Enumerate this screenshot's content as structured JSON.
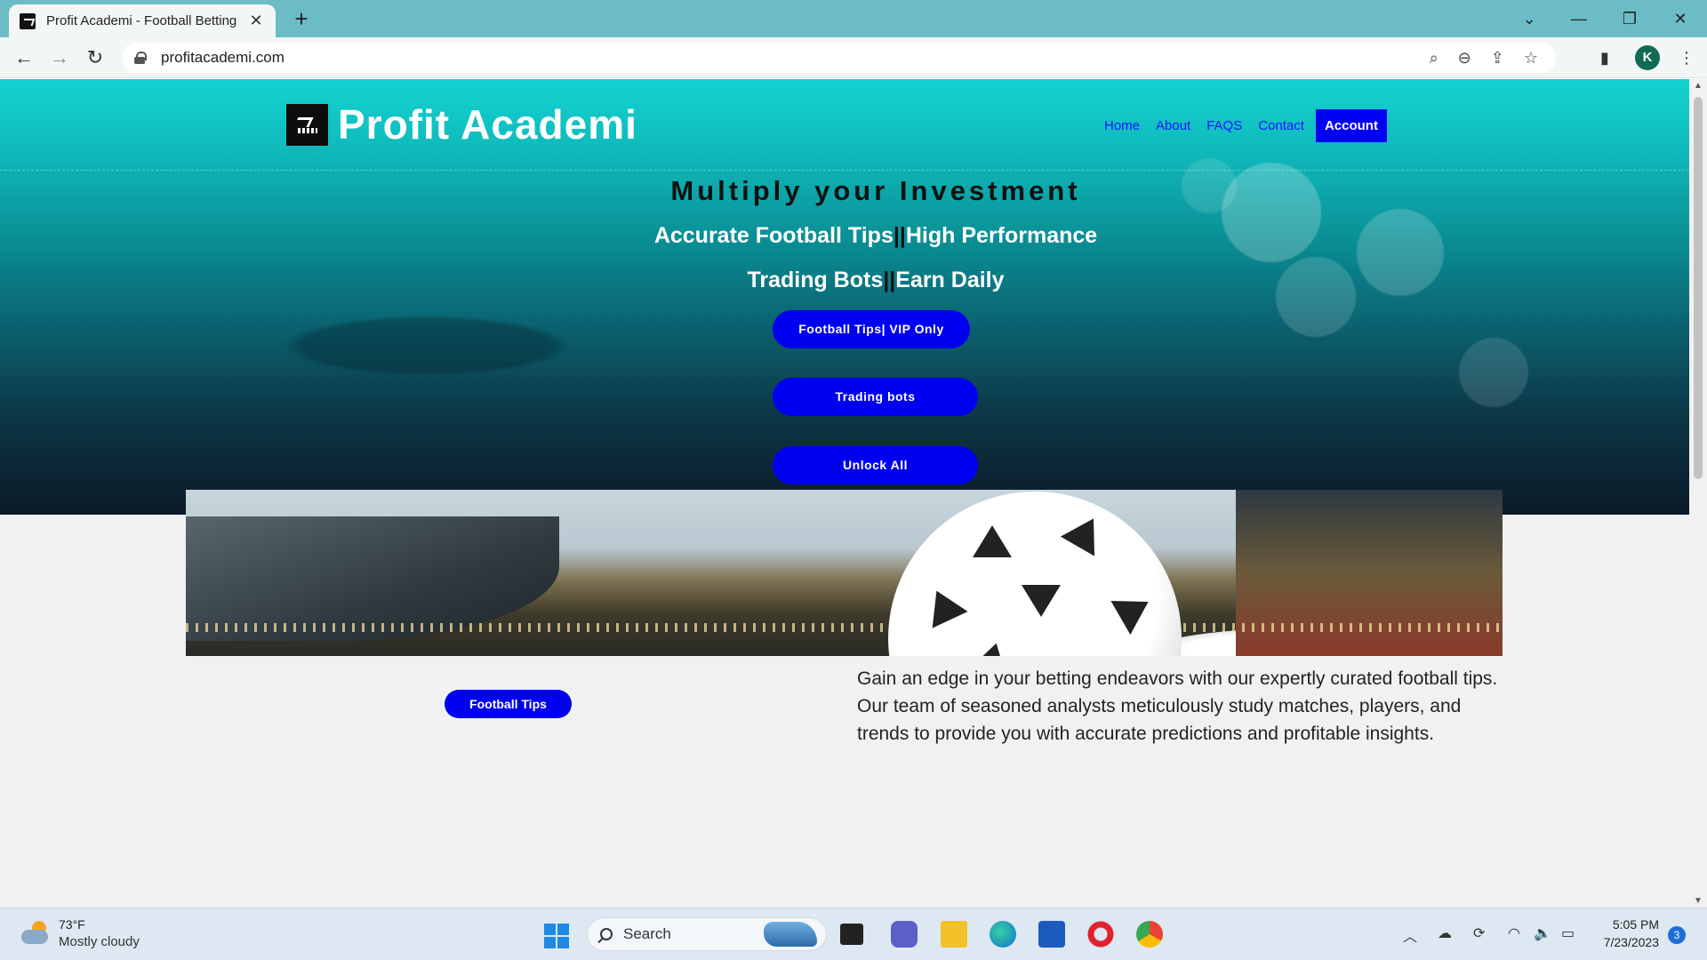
{
  "browser": {
    "tab_title": "Profit Academi - Football Betting",
    "tab_close": "✕",
    "new_tab": "+",
    "url": "profitacademi.com",
    "profile_initial": "K",
    "window_controls": {
      "minimize": "—",
      "maximize": "❐",
      "close": "✕",
      "tab_list": "⌄"
    }
  },
  "site": {
    "brand": "Profit Academi",
    "nav": [
      "Home",
      "About",
      "FAQS",
      "Contact",
      "Account"
    ],
    "hero_title": "Multiply your Investment",
    "tagline_1a": "Accurate Football Tips",
    "tagline_1b": "High Performance",
    "tagline_2a": "Trading Bots",
    "tagline_2b": "Earn Daily",
    "bars": "||",
    "buttons": [
      "Football Tips| VIP Only",
      "Trading bots",
      "Unlock All"
    ],
    "section_button": "Football Tips",
    "description": "Gain an edge in your betting endeavors with our expertly curated football tips. Our team of seasoned analysts meticulously study matches, players, and trends to provide you with accurate predictions and profitable insights."
  },
  "taskbar": {
    "temperature": "73°F",
    "weather": "Mostly cloudy",
    "search_placeholder": "Search",
    "time": "5:05 PM",
    "date": "7/23/2023",
    "notification_count": "3"
  },
  "colors": {
    "accent_button": "#0000f0",
    "nav_link": "#1a14ff",
    "hero_top": "#14d3d2",
    "hero_bottom": "#0c1a28"
  },
  "icons": [
    "back-icon",
    "forward-icon",
    "reload-icon",
    "lock-icon",
    "search-icon",
    "zoom-icon",
    "share-icon",
    "star-icon",
    "sidepanel-icon",
    "menu-icon",
    "windows-start-icon",
    "file-explorer-icon",
    "edge-icon",
    "store-icon",
    "opera-icon",
    "chrome-icon",
    "wifi-icon",
    "volume-icon",
    "battery-icon"
  ]
}
